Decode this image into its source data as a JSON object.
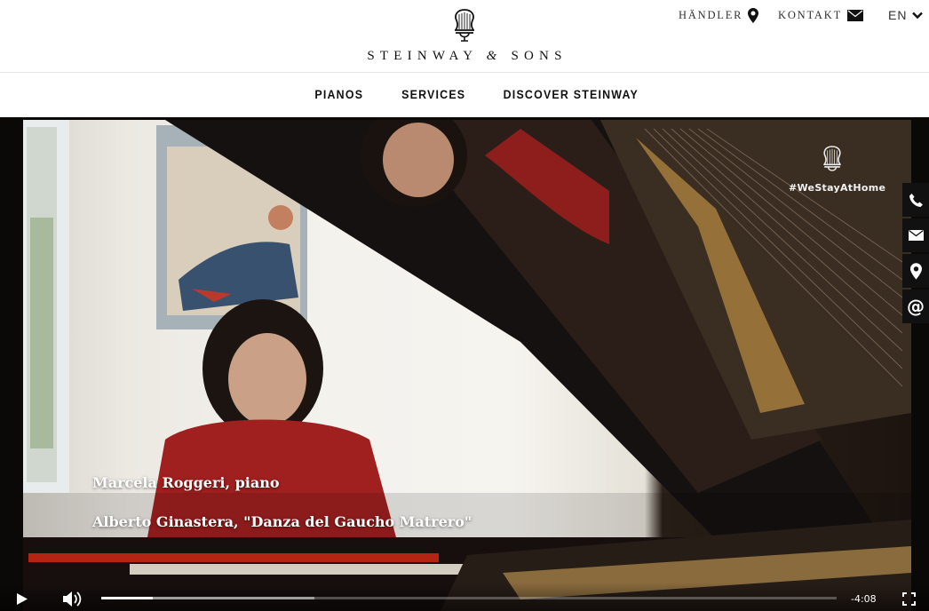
{
  "header": {
    "brand_main": "STEINWAY",
    "brand_amp": "&",
    "brand_tail": "SONS",
    "dealer_label": "HÄNDLER",
    "contact_label": "KONTAKT",
    "language": "EN"
  },
  "nav": {
    "items": [
      {
        "label": "PIANOS"
      },
      {
        "label": "SERVICES"
      },
      {
        "label": "DISCOVER STEINWAY"
      }
    ]
  },
  "video": {
    "title_line1": "Marcela Roggeri, piano",
    "title_line2": "Alberto Ginastera, \"Danza del Gaucho Matrero\"",
    "hashtag": "#WeStayAtHome",
    "time_remaining": "-4:08",
    "progress_played": 0.07,
    "progress_buffered": 0.29
  },
  "sidebar": {
    "items": [
      {
        "icon": "phone-icon"
      },
      {
        "icon": "mail-icon"
      },
      {
        "icon": "location-icon"
      },
      {
        "icon": "at-icon",
        "glyph": "@"
      }
    ]
  },
  "colors": {
    "accent_red": "#b42413",
    "dark": "#111111"
  }
}
